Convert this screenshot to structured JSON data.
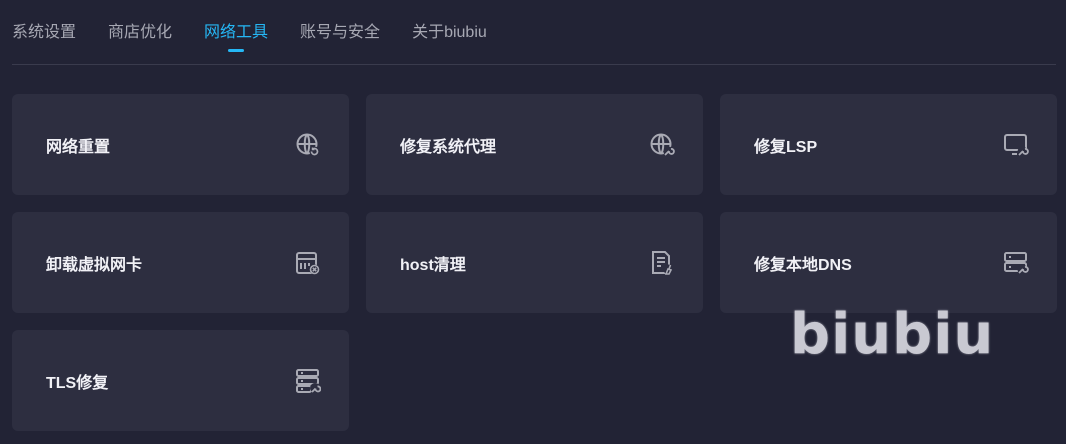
{
  "tabs": [
    {
      "label": "系统设置",
      "active": false
    },
    {
      "label": "商店优化",
      "active": false
    },
    {
      "label": "网络工具",
      "active": true
    },
    {
      "label": "账号与安全",
      "active": false
    },
    {
      "label": "关于biubiu",
      "active": false
    }
  ],
  "cards": [
    {
      "label": "网络重置",
      "icon": "globe-refresh-icon"
    },
    {
      "label": "修复系统代理",
      "icon": "globe-wrench-icon"
    },
    {
      "label": "修复LSP",
      "icon": "monitor-wrench-icon"
    },
    {
      "label": "卸载虚拟网卡",
      "icon": "network-card-remove-icon"
    },
    {
      "label": "host清理",
      "icon": "document-clean-icon"
    },
    {
      "label": "修复本地DNS",
      "icon": "server-wrench-icon"
    },
    {
      "label": "TLS修复",
      "icon": "server-tool-icon"
    }
  ],
  "watermark": "biubiu",
  "colors": {
    "background": "#222335",
    "card": "#2d2e40",
    "accent": "#25b7f5",
    "tab_text": "#a7a8b3"
  }
}
